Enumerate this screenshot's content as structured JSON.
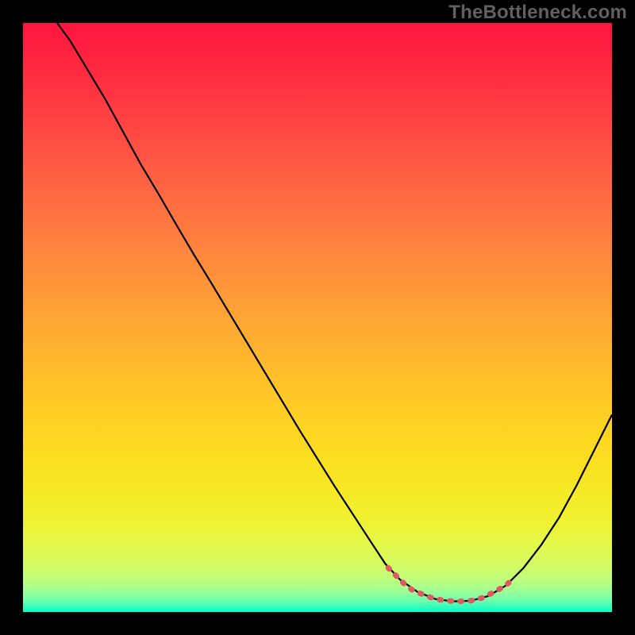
{
  "watermark": "TheBottleneck.com",
  "gradient": {
    "stops": [
      {
        "offset": 0.0,
        "color": "#ff163e"
      },
      {
        "offset": 0.05,
        "color": "#ff2140"
      },
      {
        "offset": 0.1,
        "color": "#ff2f41"
      },
      {
        "offset": 0.15,
        "color": "#ff3e42"
      },
      {
        "offset": 0.2,
        "color": "#ff4d43"
      },
      {
        "offset": 0.25,
        "color": "#ff5c43"
      },
      {
        "offset": 0.3,
        "color": "#ff6b42"
      },
      {
        "offset": 0.35,
        "color": "#ff7a40"
      },
      {
        "offset": 0.4,
        "color": "#ff893d"
      },
      {
        "offset": 0.45,
        "color": "#ff9739"
      },
      {
        "offset": 0.5,
        "color": "#ffa535"
      },
      {
        "offset": 0.55,
        "color": "#ffb22f"
      },
      {
        "offset": 0.6,
        "color": "#ffbf2a"
      },
      {
        "offset": 0.65,
        "color": "#ffcb25"
      },
      {
        "offset": 0.7,
        "color": "#fed621"
      },
      {
        "offset": 0.75,
        "color": "#fbe120"
      },
      {
        "offset": 0.8,
        "color": "#f6ea26"
      },
      {
        "offset": 0.85,
        "color": "#eef233"
      },
      {
        "offset": 0.88,
        "color": "#e6f746"
      },
      {
        "offset": 0.91,
        "color": "#d9fa5c"
      },
      {
        "offset": 0.94,
        "color": "#c3fd76"
      },
      {
        "offset": 0.96,
        "color": "#a7ff8f"
      },
      {
        "offset": 0.98,
        "color": "#73ffab"
      },
      {
        "offset": 1.0,
        "color": "#00ffc8"
      }
    ]
  },
  "chart_data": {
    "type": "line",
    "title": "",
    "xlabel": "",
    "ylabel": "",
    "xlim": [
      0,
      1
    ],
    "ylim": [
      0,
      1
    ],
    "series": [
      {
        "name": "curve",
        "color": "#000000",
        "stroke_width": 2.2,
        "points": [
          {
            "x": 0.058,
            "y": 1.0
          },
          {
            "x": 0.08,
            "y": 0.97
          },
          {
            "x": 0.11,
            "y": 0.92
          },
          {
            "x": 0.14,
            "y": 0.87
          },
          {
            "x": 0.17,
            "y": 0.815
          },
          {
            "x": 0.2,
            "y": 0.76
          },
          {
            "x": 0.23,
            "y": 0.71
          },
          {
            "x": 0.26,
            "y": 0.658
          },
          {
            "x": 0.29,
            "y": 0.607
          },
          {
            "x": 0.32,
            "y": 0.558
          },
          {
            "x": 0.35,
            "y": 0.508
          },
          {
            "x": 0.38,
            "y": 0.458
          },
          {
            "x": 0.41,
            "y": 0.408
          },
          {
            "x": 0.44,
            "y": 0.358
          },
          {
            "x": 0.47,
            "y": 0.308
          },
          {
            "x": 0.5,
            "y": 0.26
          },
          {
            "x": 0.53,
            "y": 0.212
          },
          {
            "x": 0.56,
            "y": 0.166
          },
          {
            "x": 0.59,
            "y": 0.12
          },
          {
            "x": 0.615,
            "y": 0.082
          },
          {
            "x": 0.64,
            "y": 0.055
          },
          {
            "x": 0.67,
            "y": 0.034
          },
          {
            "x": 0.7,
            "y": 0.022
          },
          {
            "x": 0.73,
            "y": 0.018
          },
          {
            "x": 0.76,
            "y": 0.019
          },
          {
            "x": 0.79,
            "y": 0.027
          },
          {
            "x": 0.82,
            "y": 0.045
          },
          {
            "x": 0.85,
            "y": 0.075
          },
          {
            "x": 0.88,
            "y": 0.114
          },
          {
            "x": 0.91,
            "y": 0.16
          },
          {
            "x": 0.94,
            "y": 0.215
          },
          {
            "x": 0.97,
            "y": 0.275
          },
          {
            "x": 1.0,
            "y": 0.335
          }
        ]
      },
      {
        "name": "bottom-highlight",
        "color": "#e05a62",
        "stroke_width": 7,
        "stroke_linecap": "round",
        "dash": "2 11",
        "points": [
          {
            "x": 0.62,
            "y": 0.075
          },
          {
            "x": 0.645,
            "y": 0.05
          },
          {
            "x": 0.66,
            "y": 0.038
          },
          {
            "x": 0.68,
            "y": 0.029
          },
          {
            "x": 0.7,
            "y": 0.022
          },
          {
            "x": 0.72,
            "y": 0.019
          },
          {
            "x": 0.74,
            "y": 0.018
          },
          {
            "x": 0.76,
            "y": 0.019
          },
          {
            "x": 0.78,
            "y": 0.024
          },
          {
            "x": 0.8,
            "y": 0.034
          },
          {
            "x": 0.82,
            "y": 0.045
          },
          {
            "x": 0.835,
            "y": 0.06
          }
        ]
      }
    ]
  }
}
